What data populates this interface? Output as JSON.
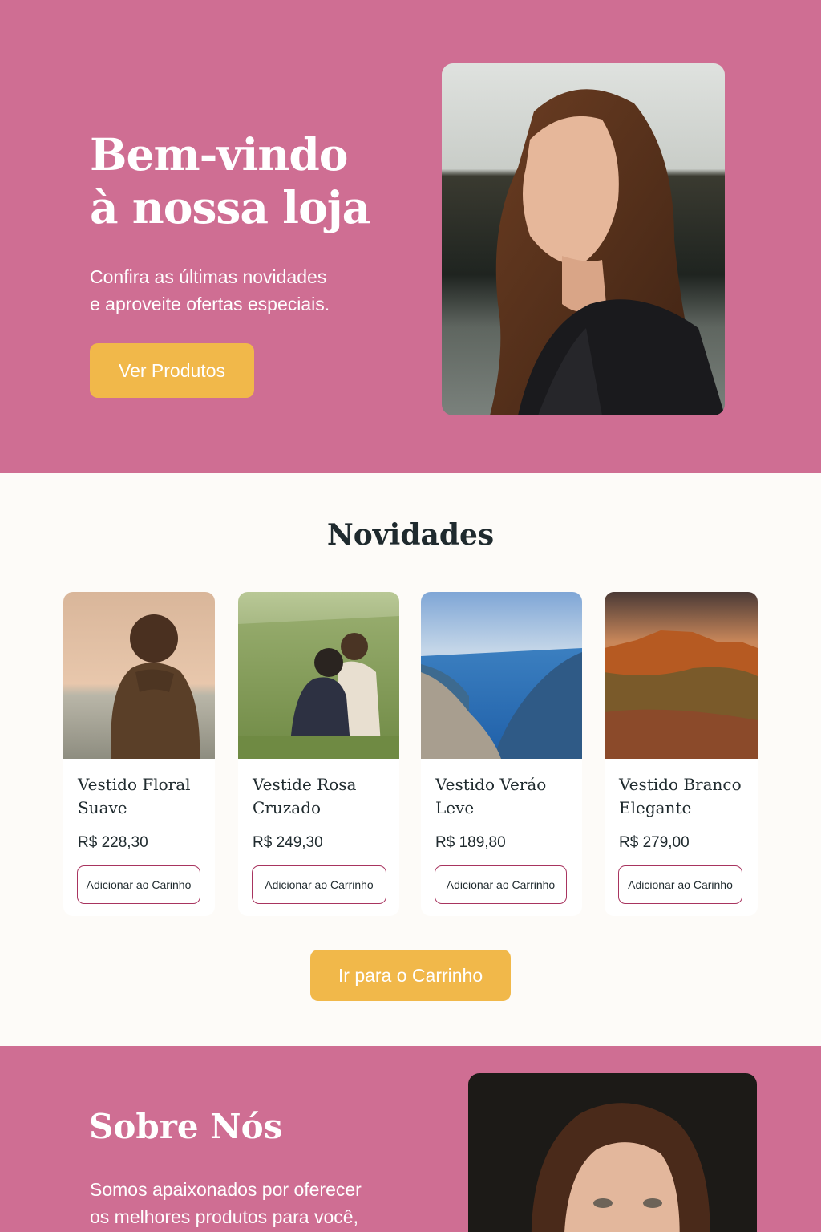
{
  "hero": {
    "title_line1": "Bem-vindo",
    "title_line2": "à nossa loja",
    "subtitle_line1": "Confira as últimas novidades",
    "subtitle_line2": "e aproveite ofertas especiais.",
    "cta_label": "Ver Produtos"
  },
  "products": {
    "title": "Novidades",
    "items": [
      {
        "name_line1": "Vestido Floral",
        "name_line2": "Suave",
        "price": "R$ 228,30",
        "button": "Adicionar ao Carinho"
      },
      {
        "name_line1": "Vestide Rosa",
        "name_line2": "Cruzado",
        "price": "R$ 249,30",
        "button": "Adicionar ao Carrinho"
      },
      {
        "name_line1": "Vestido Veráo",
        "name_line2": "Leve",
        "price": "R$ 189,80",
        "button": "Adicionar ao Carrinho"
      },
      {
        "name_line1": "Vestido Branco",
        "name_line2": "Elegante",
        "price": "R$ 279,00",
        "button": "Adicionar ao Carinho"
      }
    ],
    "cart_label": "Ir para o Carrinho"
  },
  "about": {
    "title": "Sobre Nós",
    "text_line1": "Somos apaixonados por oferecer",
    "text_line2": "os melhores produtos para você,"
  },
  "colors": {
    "primary_pink": "#cf6e93",
    "accent_yellow": "#f1b84a",
    "button_border": "#a8345f",
    "background": "#fdfbf8"
  }
}
